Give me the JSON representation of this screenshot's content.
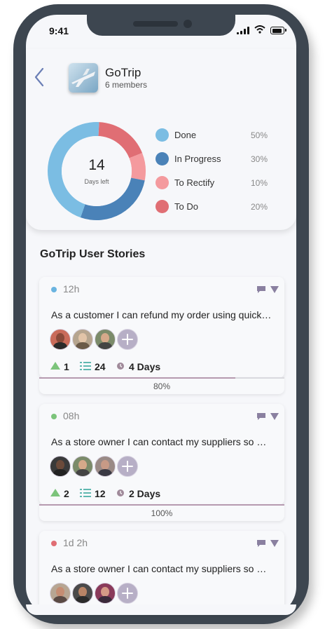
{
  "status_bar": {
    "time": "9:41"
  },
  "project": {
    "name": "GoTrip",
    "members": "6 members"
  },
  "summary": {
    "count": "14",
    "caption": "Days left"
  },
  "chart_data": {
    "type": "pie",
    "categories": [
      "Done",
      "In Progress",
      "To Rectify",
      "To Do"
    ],
    "values": [
      50,
      30,
      10,
      20
    ],
    "labels": [
      "50%",
      "30%",
      "10%",
      "20%"
    ],
    "colors": [
      "#7bbde3",
      "#4a82b8",
      "#f49a9e",
      "#e06e74"
    ]
  },
  "section_title": "GoTrip User Stories",
  "stories": [
    {
      "time": "12h",
      "dot_color": "#6ab4e0",
      "text": "As a customer I can refund my order using quick…",
      "upvotes": "1",
      "tasks": "24",
      "days": "4 Days",
      "progress_label": "80%",
      "progress": 0.8
    },
    {
      "time": "08h",
      "dot_color": "#7cc47b",
      "text": "As a store owner I can contact my suppliers so …",
      "upvotes": "2",
      "tasks": "12",
      "days": "2 Days",
      "progress_label": "100%",
      "progress": 1.0
    },
    {
      "time": "1d 2h",
      "dot_color": "#e06e74",
      "text": "As a store owner I can contact my suppliers so …"
    }
  ],
  "icons": {
    "back": "chevron-left-icon",
    "comment": "comment-icon",
    "filter": "triangle-down-icon",
    "upvote": "triangle-up-icon",
    "tasks": "list-icon",
    "clock": "clock-icon",
    "add": "plus-icon"
  }
}
